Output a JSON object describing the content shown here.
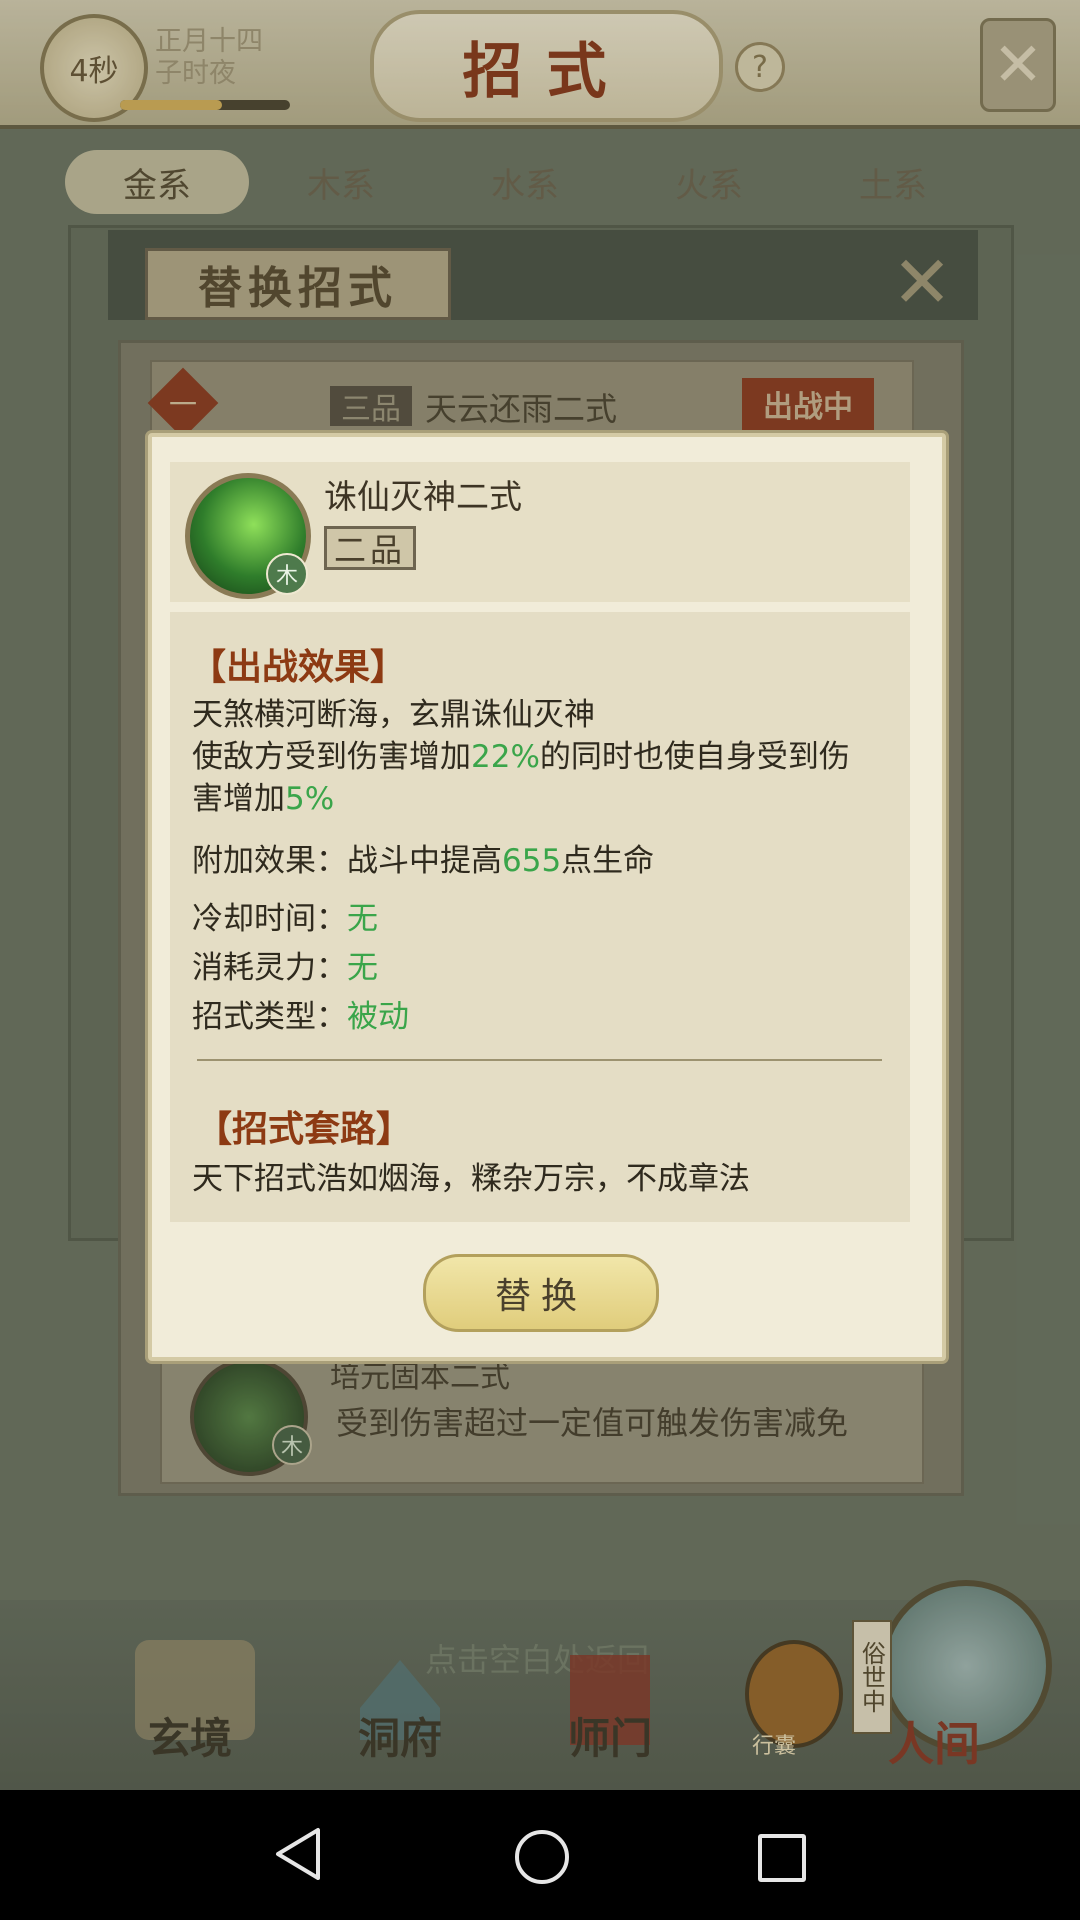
{
  "topbar": {
    "timer": "4秒",
    "date_line1": "正月十四",
    "date_line2": "子时夜",
    "time_progress": 0.6,
    "title": "招式",
    "help_symbol": "?",
    "close_symbol": "✕"
  },
  "tabs": [
    "金系",
    "木系",
    "水系",
    "火系",
    "土系"
  ],
  "replace_panel": {
    "title": "替换招式",
    "close_symbol": "✕"
  },
  "list": {
    "row1": {
      "rank": "一",
      "tier": "三品",
      "name": "天云还雨二式",
      "badge": "出战中"
    },
    "row_last": {
      "name": "培元固本二式",
      "element": "木",
      "desc": "受到伤害超过一定值可触发伤害减免"
    }
  },
  "modal": {
    "skill_name": "诛仙灭神二式",
    "tier": "二品",
    "element": "木",
    "effect_title": "【出战效果】",
    "effect_line1": "天煞横河断海，玄鼎诛仙灭神",
    "effect_line2_a": "使敌方受到伤害增加",
    "effect_line2_v": "22%",
    "effect_line2_b": "的同时也使自身受到伤",
    "effect_line3_a": "害增加",
    "effect_line3_v": "5%",
    "bonus_label": "附加效果：战斗中提高",
    "bonus_value": "655",
    "bonus_suffix": "点生命",
    "cooldown_label": "冷却时间：",
    "cooldown_value": "无",
    "cost_label": "消耗灵力：",
    "cost_value": "无",
    "type_label": "招式类型：",
    "type_value": "被动",
    "route_title": "【招式套路】",
    "route_text": "天下招式浩如烟海，糅杂万宗，不成章法",
    "replace_button": "替换"
  },
  "bottom": {
    "hint": "点击空白处返回",
    "nav": [
      "玄境",
      "洞府",
      "师门"
    ],
    "bag_label": "行囊",
    "world_side": "俗世中",
    "world_label": "人间"
  },
  "colors": {
    "accent_green": "#3aa54a",
    "title_red": "#8d3a13"
  }
}
